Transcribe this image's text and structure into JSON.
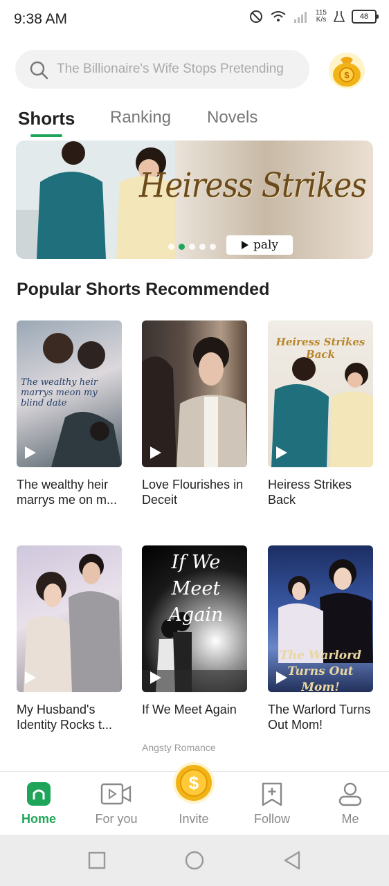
{
  "status": {
    "time": "9:38 AM",
    "speed_top": "115",
    "speed_bottom": "K/s",
    "battery": "48"
  },
  "search": {
    "placeholder": "The Billionaire's Wife Stops Pretending"
  },
  "tabs": [
    {
      "label": "Shorts",
      "active": true
    },
    {
      "label": "Ranking",
      "active": false
    },
    {
      "label": "Novels",
      "active": false
    }
  ],
  "banner": {
    "title": "Heiress Strikes Back",
    "play_label": "paly",
    "dots": 5,
    "active_dot": 2
  },
  "section": {
    "title": "Popular Shorts Recommended"
  },
  "shorts": [
    {
      "title": "The wealthy heir marrys me on m...",
      "poster_text": "The wealthy heir marrys meon my blind date"
    },
    {
      "title": "Love Flourishes in Deceit"
    },
    {
      "title": "Heiress Strikes Back",
      "poster_text": "Heiress Strikes Back"
    },
    {
      "title": "My Husband's Identity Rocks t..."
    },
    {
      "title": "If We Meet Again",
      "poster_text": "If We Meet Again",
      "tag": "Angsty Romance"
    },
    {
      "title": "The Warlord Turns Out Mom!",
      "poster_text": "The Warlord Turns Out Mom!"
    }
  ],
  "nav": [
    {
      "label": "Home",
      "icon": "home-icon",
      "active": true
    },
    {
      "label": "For you",
      "icon": "video-icon",
      "active": false
    },
    {
      "label": "Invite",
      "icon": "coin-icon",
      "active": false
    },
    {
      "label": "Follow",
      "icon": "bookmark-plus-icon",
      "active": false
    },
    {
      "label": "Me",
      "icon": "profile-icon",
      "active": false
    }
  ],
  "colors": {
    "accent": "#1fa55a",
    "coin": "#f2b318"
  }
}
